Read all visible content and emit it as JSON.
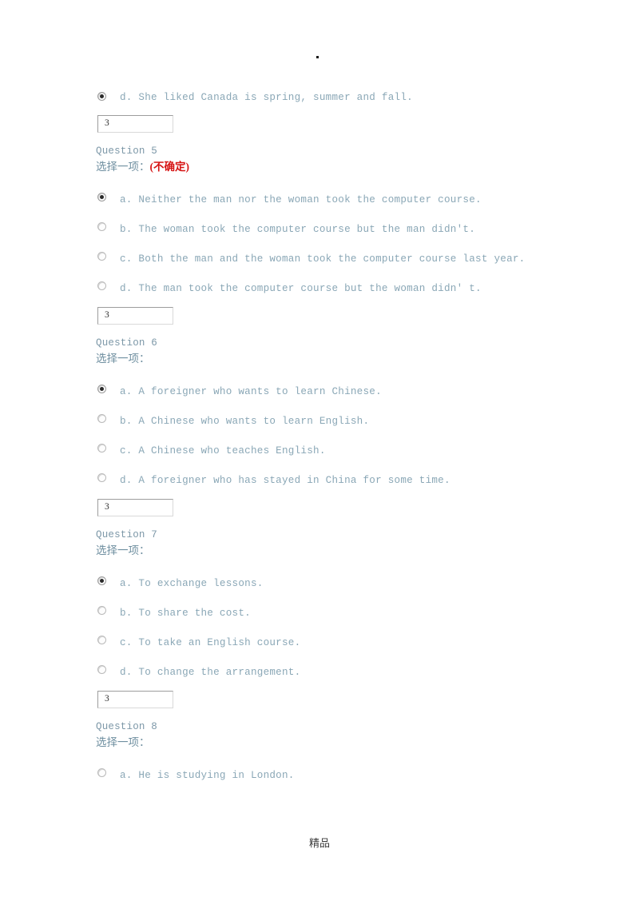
{
  "page": {
    "top_marker": ".",
    "footer_text": "精品",
    "colors": {
      "option_text": "#8aa7b6",
      "question_heading": "#7d98a8",
      "prompt": "#6f8fa0",
      "uncertain": "#d61414",
      "footer": "#3a3a3a"
    }
  },
  "leading_option": {
    "letter_text": "d. She liked Canada is spring, summer and fall.",
    "selected": true
  },
  "leading_answer_box": {
    "value": "3"
  },
  "questions": [
    {
      "heading": "Question 5",
      "prompt": "选择一项：",
      "uncertain_note": "(不确定)",
      "options": [
        {
          "text": "a. Neither the man nor the woman took the computer course.",
          "selected": true
        },
        {
          "text": "b. The woman took the computer course but the man didn't.",
          "selected": false
        },
        {
          "text": "c. Both the man and the woman took the computer course last year.",
          "selected": false
        },
        {
          "text": "d. The man took the computer course but the woman didn' t.",
          "selected": false
        }
      ],
      "answer_box": {
        "value": "3"
      }
    },
    {
      "heading": "Question 6",
      "prompt": "选择一项：",
      "uncertain_note": "",
      "options": [
        {
          "text": "a. A foreigner who wants to learn Chinese.",
          "selected": true
        },
        {
          "text": "b. A Chinese who wants to learn English.",
          "selected": false
        },
        {
          "text": "c. A Chinese who teaches English.",
          "selected": false
        },
        {
          "text": "d. A foreigner who has stayed in China for some time.",
          "selected": false
        }
      ],
      "answer_box": {
        "value": "3"
      }
    },
    {
      "heading": "Question 7",
      "prompt": "选择一项：",
      "uncertain_note": "",
      "options": [
        {
          "text": "a. To exchange lessons.",
          "selected": true
        },
        {
          "text": "b. To share the cost.",
          "selected": false
        },
        {
          "text": "c. To take an English course.",
          "selected": false
        },
        {
          "text": "d. To change the arrangement.",
          "selected": false
        }
      ],
      "answer_box": {
        "value": "3"
      }
    },
    {
      "heading": "Question 8",
      "prompt": "选择一项：",
      "uncertain_note": "",
      "options": [
        {
          "text": "a. He is studying in London.",
          "selected": false
        }
      ],
      "answer_box": null
    }
  ]
}
